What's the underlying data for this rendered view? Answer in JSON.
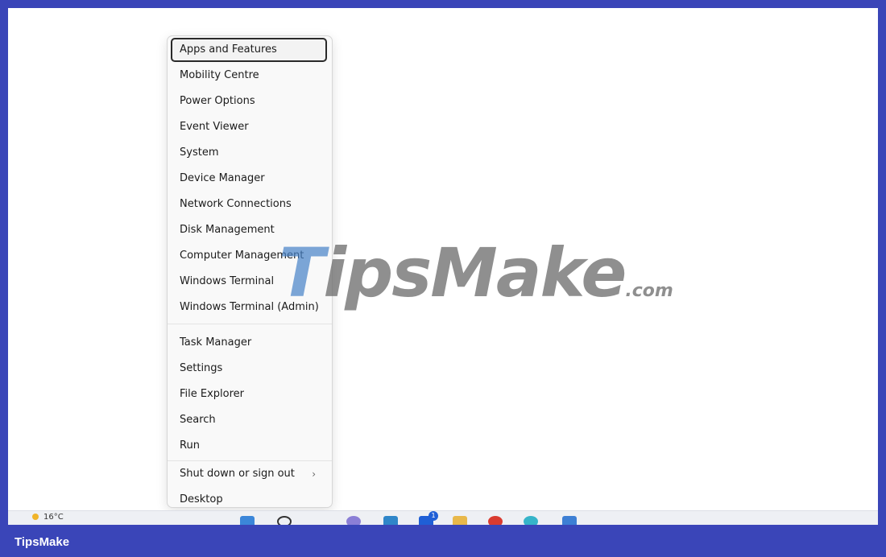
{
  "menu": {
    "items": [
      {
        "label": "Apps and Features",
        "focused": true
      },
      {
        "label": "Mobility Centre"
      },
      {
        "label": "Power Options"
      },
      {
        "label": "Event Viewer"
      },
      {
        "label": "System"
      },
      {
        "label": "Device Manager"
      },
      {
        "label": "Network Connections"
      },
      {
        "label": "Disk Management"
      },
      {
        "label": "Computer Management"
      },
      {
        "label": "Windows Terminal"
      },
      {
        "label": "Windows Terminal (Admin)"
      },
      {
        "label": "Task Manager"
      },
      {
        "label": "Settings"
      },
      {
        "label": "File Explorer"
      },
      {
        "label": "Search"
      },
      {
        "label": "Run"
      },
      {
        "label": "Shut down or sign out",
        "submenu_icon": "chevron-right-icon"
      },
      {
        "label": "Desktop"
      }
    ]
  },
  "watermark": {
    "brand": "TipsMake",
    "suffix": ".com"
  },
  "taskbar": {
    "weather_temp": "16°C",
    "badge_count": "1"
  },
  "footer": {
    "brand": "TipsMake"
  },
  "colors": {
    "frame": "#3a45b8",
    "menu_bg": "#f9f9f9",
    "focus_border": "#2a2a2a"
  }
}
